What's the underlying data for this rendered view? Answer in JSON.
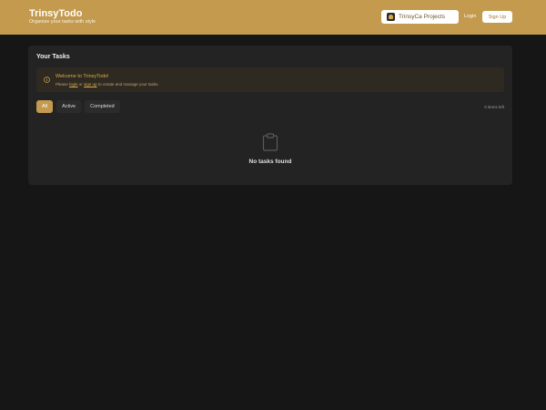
{
  "header": {
    "title": "TrinsyTodo",
    "tagline": "Organize your tasks with style",
    "projects_label": "TrinsyCa Projects",
    "login_label": "Login",
    "signup_label": "Sign Up"
  },
  "tasks_card": {
    "title": "Your Tasks",
    "notice": {
      "heading": "Welcome to TrinsyTodo!",
      "body_prefix": "Please ",
      "login_link": "login",
      "body_middle": " or ",
      "signup_link": "sign up",
      "body_suffix": " to create and manage your tasks."
    },
    "filters": [
      "All",
      "Active",
      "Completed"
    ],
    "selected_filter": "All",
    "items_left": "0 items left",
    "empty_message": "No tasks found"
  },
  "colors": {
    "accent": "#c39a4e",
    "background": "#161616",
    "card": "#232323",
    "notice_text": "#d8a94f"
  },
  "icons": {
    "projects": "trinsyca-logo-icon",
    "notice": "info-icon",
    "empty": "clipboard-icon"
  }
}
